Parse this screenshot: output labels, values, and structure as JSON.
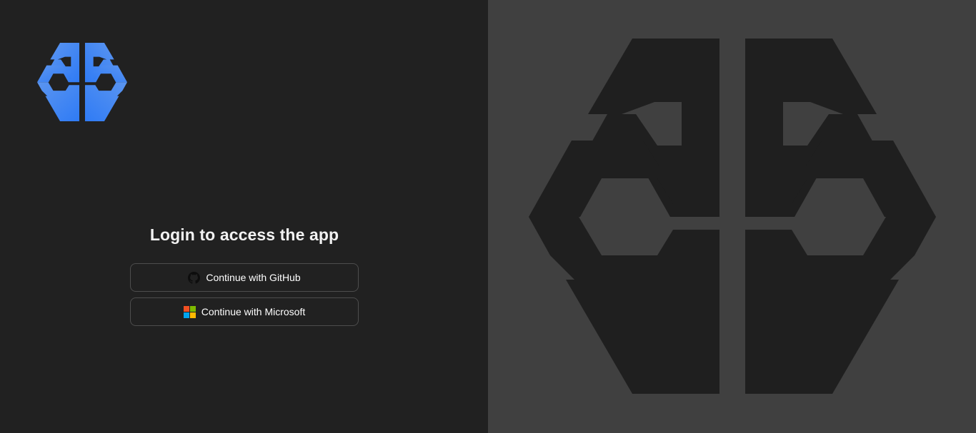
{
  "login": {
    "title": "Login to access the app",
    "github_button_label": "Continue with GitHub",
    "microsoft_button_label": "Continue with Microsoft"
  },
  "icons": {
    "logo": "brain-hexagon-icon",
    "github": "github-icon",
    "microsoft": "microsoft-icon"
  },
  "colors": {
    "left_background": "#212121",
    "right_background": "#404040",
    "logo_gradient_start": "#5b95f0",
    "logo_gradient_end": "#2f7bf5",
    "large_logo_fill": "#1f1f1f",
    "button_border": "#4d4d4d",
    "microsoft_red": "#f25022",
    "microsoft_green": "#7fba00",
    "microsoft_blue": "#00a4ef",
    "microsoft_yellow": "#ffb900"
  }
}
